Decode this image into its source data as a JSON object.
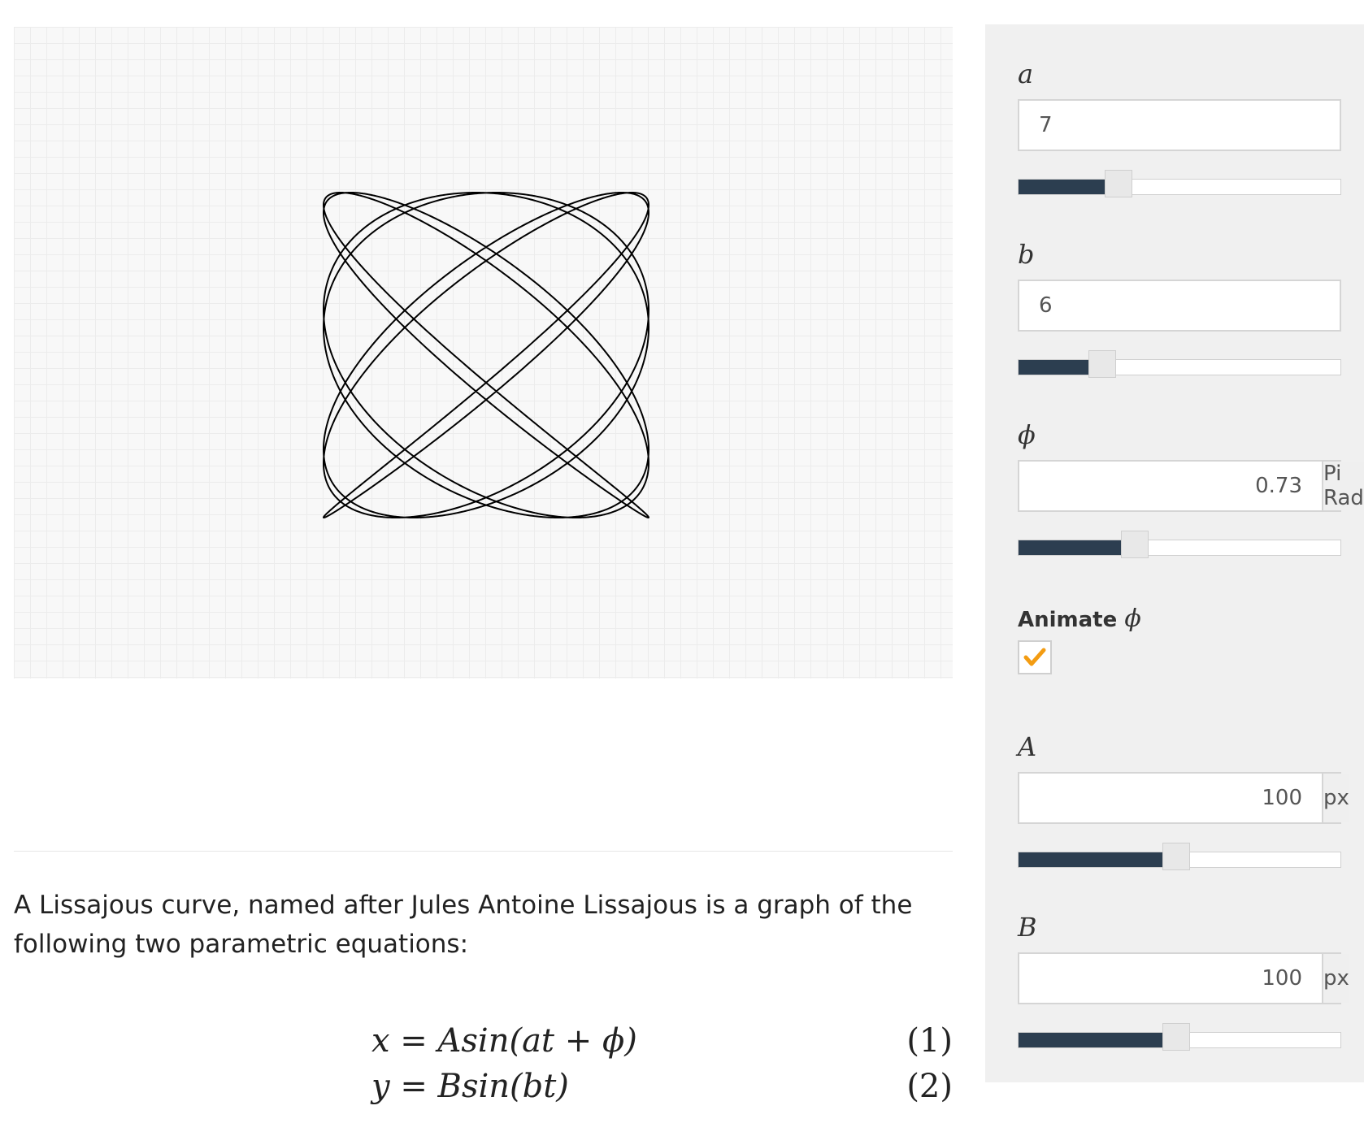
{
  "controls": {
    "a": {
      "label": "a",
      "value": "7",
      "slider_fraction": 0.31
    },
    "b": {
      "label": "b",
      "value": "6",
      "slider_fraction": 0.26
    },
    "phi": {
      "label": "ϕ",
      "value": "0.73",
      "unit": "Pi Radians",
      "slider_fraction": 0.36
    },
    "animate": {
      "label": "Animate",
      "symbol": "ϕ",
      "checked": true
    },
    "A": {
      "label": "A",
      "value": "100",
      "unit": "px",
      "slider_fraction": 0.49
    },
    "B": {
      "label": "B",
      "value": "100",
      "unit": "px",
      "slider_fraction": 0.49
    }
  },
  "description": "A Lissajous curve, named after Jules Antoine Lissajous is a graph of the following two parametric equations:",
  "equations": [
    {
      "text": "x = Asin(at + ϕ)",
      "number": "(1)"
    },
    {
      "text": "y = Bsin(bt)",
      "number": "(2)"
    }
  ],
  "colors": {
    "curve": "#000000",
    "slider_fill": "#2c3e50",
    "check_mark": "#f39c12",
    "panel_bg": "#f0f0f0"
  }
}
